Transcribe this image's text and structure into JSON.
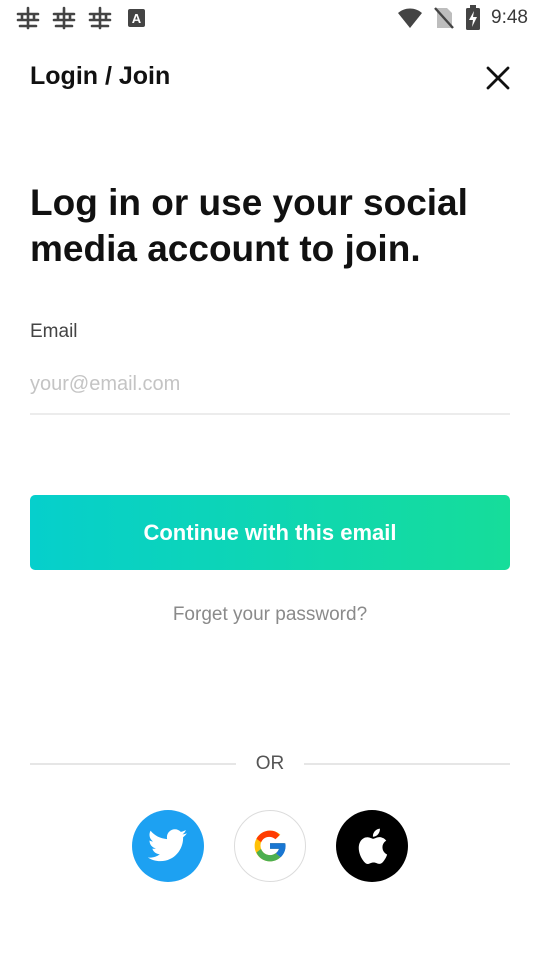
{
  "status_bar": {
    "time": "9:48",
    "left_icons": [
      "bug-icon",
      "bug-icon",
      "bug-icon",
      "keyboard-a-icon"
    ],
    "right_icons": [
      "wifi-icon",
      "no-sim-icon",
      "battery-charging-icon"
    ]
  },
  "header": {
    "title": "Login / Join",
    "close_icon": "close-icon"
  },
  "main": {
    "headline": "Log in or use your social media account to join.",
    "email_label": "Email",
    "email_placeholder": "your@email.com",
    "email_value": "",
    "continue_label": "Continue with this email",
    "forgot_label": "Forget your password?",
    "or_label": "OR"
  },
  "social": {
    "buttons": [
      "twitter-icon",
      "google-icon",
      "apple-icon"
    ]
  },
  "colors": {
    "gradient_start": "#06cfcc",
    "gradient_end": "#16dd9a",
    "twitter": "#1da1f2",
    "apple": "#000000"
  }
}
